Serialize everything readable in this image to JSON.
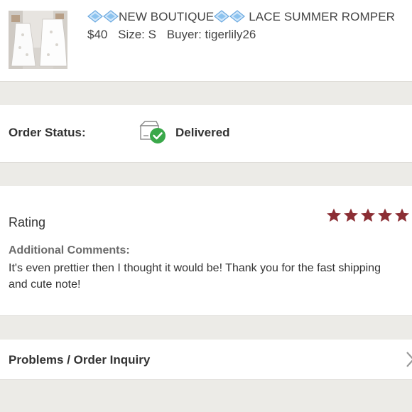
{
  "product": {
    "title_prefix": "",
    "title_mid": "NEW BOUTIQUE",
    "title_suffix": " LACE SUMMER ROMPER",
    "price": "$40",
    "size": "Size: S",
    "buyer": "Buyer: tigerlily26"
  },
  "order": {
    "status_label": "Order Status:",
    "status_value": "Delivered"
  },
  "rating": {
    "label": "Rating",
    "stars": 5,
    "star_color": "#8b2e34",
    "comments_label": "Additional Comments:",
    "comments": "It's even prettier then I thought it would be! Thank you for the fast shipping and cute note!"
  },
  "inquiry": {
    "label": "Problems / Order Inquiry"
  },
  "colors": {
    "delivered_check": "#3aa84a",
    "gem": "#7ab6e6"
  }
}
